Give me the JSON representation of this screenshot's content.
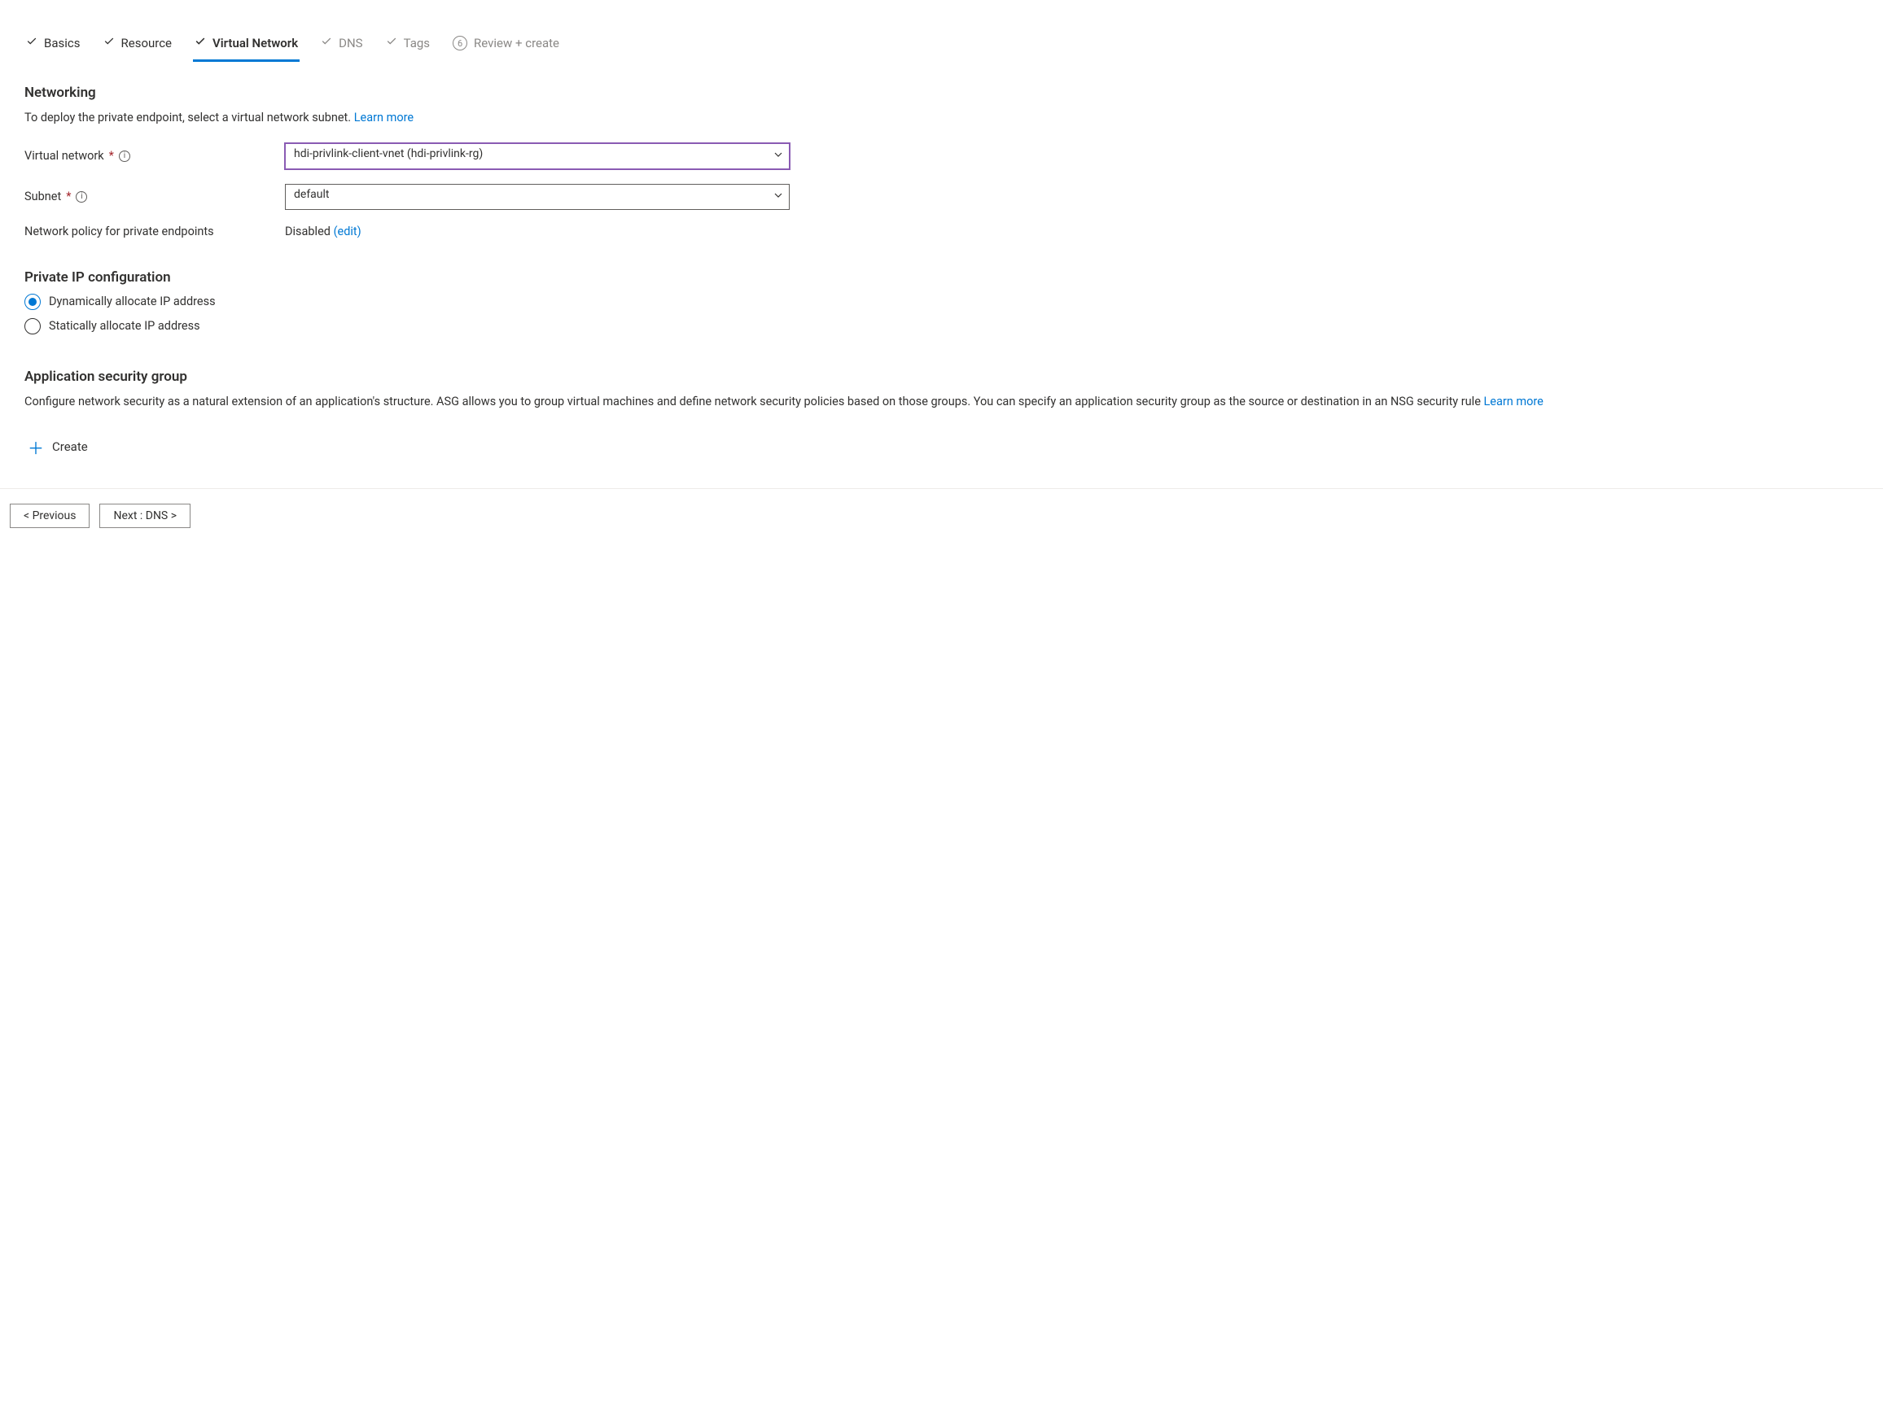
{
  "tabs": {
    "basics": "Basics",
    "resource": "Resource",
    "virtual_network": "Virtual Network",
    "dns": "DNS",
    "tags": "Tags",
    "review": "Review + create",
    "review_step": "6"
  },
  "networking": {
    "heading": "Networking",
    "desc_text": "To deploy the private endpoint, select a virtual network subnet.  ",
    "learn_more": "Learn more",
    "vnet_label": "Virtual network",
    "vnet_value": "hdi-privlink-client-vnet (hdi-privlink-rg)",
    "subnet_label": "Subnet",
    "subnet_value": "default",
    "policy_label": "Network policy for private endpoints",
    "policy_value": "Disabled",
    "policy_edit": "(edit)"
  },
  "ipconfig": {
    "heading": "Private IP configuration",
    "dynamic": "Dynamically allocate IP address",
    "static": "Statically allocate IP address"
  },
  "asg": {
    "heading": "Application security group",
    "desc_text": "Configure network security as a natural extension of an application's structure. ASG allows you to group virtual machines and define network security policies based on those groups. You can specify an application security group as the source or destination in an NSG security rule  ",
    "learn_more": "Learn more",
    "create": "Create"
  },
  "footer": {
    "previous": "< Previous",
    "next": "Next : DNS >"
  }
}
